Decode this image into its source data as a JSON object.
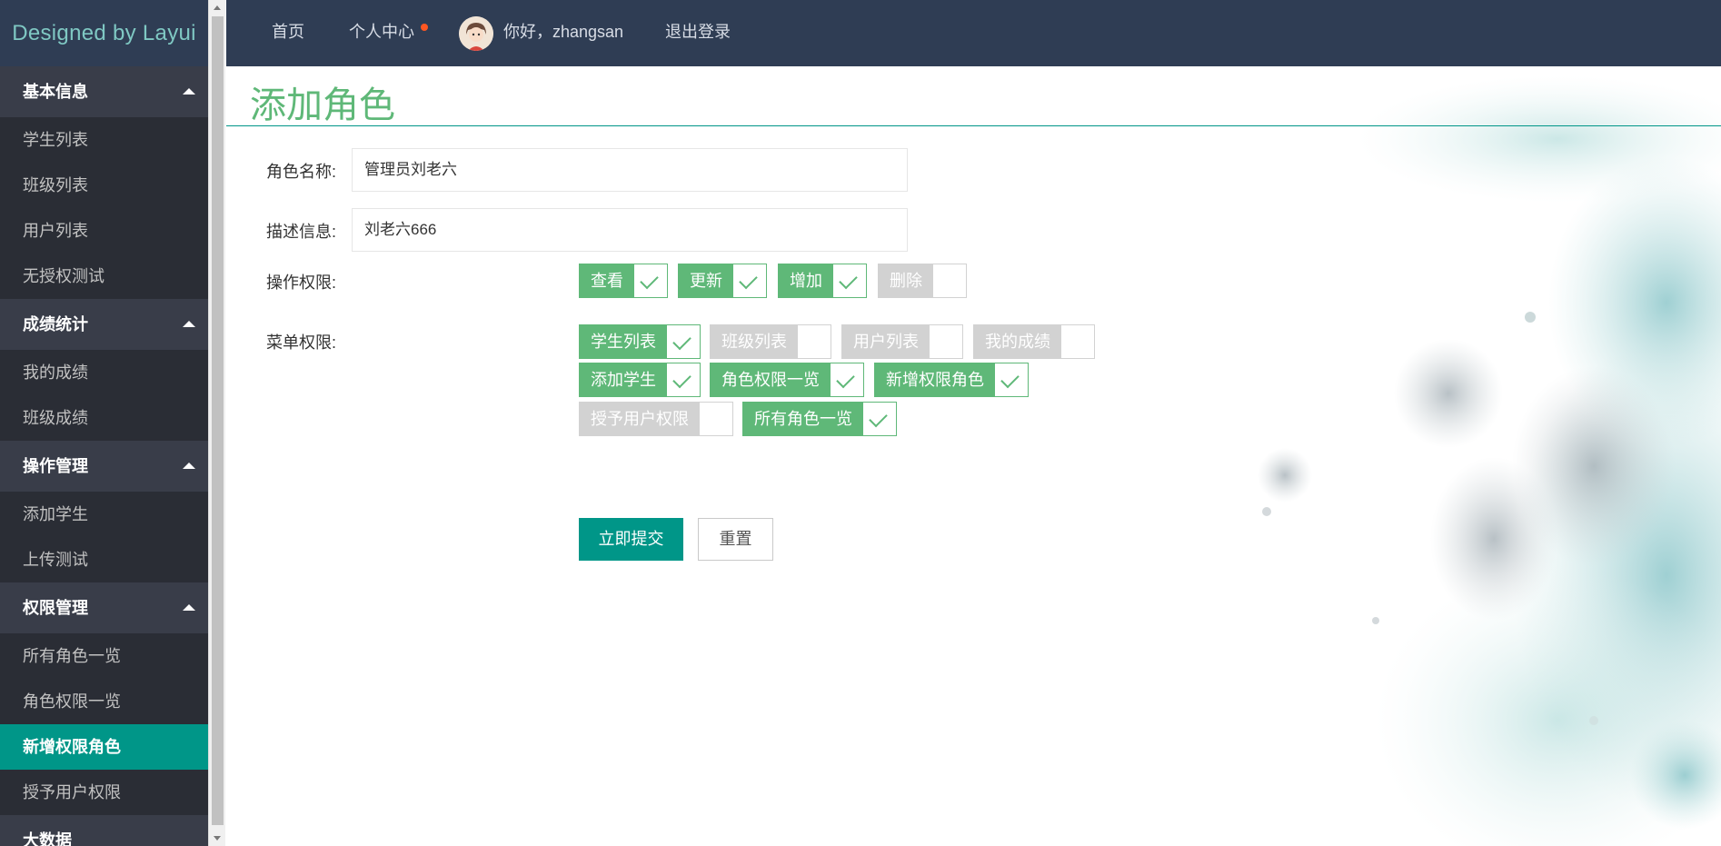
{
  "sidebar": {
    "logo": "Designed by Layui",
    "groups": [
      {
        "title": "基本信息",
        "items": [
          "学生列表",
          "班级列表",
          "用户列表",
          "无授权测试"
        ]
      },
      {
        "title": "成绩统计",
        "items": [
          "我的成绩",
          "班级成绩"
        ]
      },
      {
        "title": "操作管理",
        "items": [
          "添加学生",
          "上传测试"
        ]
      },
      {
        "title": "权限管理",
        "items": [
          "所有角色一览",
          "角色权限一览",
          "新增权限角色",
          "授予用户权限"
        ]
      },
      {
        "title": "大数据",
        "items": []
      }
    ],
    "active_item": "新增权限角色"
  },
  "header": {
    "home": "首页",
    "personal_center": "个人中心",
    "greeting": "你好，zhangsan",
    "logout": "退出登录"
  },
  "page": {
    "title": "添加角色",
    "role_name_label": "角色名称:",
    "role_name_value": "管理员刘老六",
    "description_label": "描述信息:",
    "description_value": "刘老六666",
    "operation_label": "操作权限:",
    "operations": [
      {
        "label": "查看",
        "checked": true
      },
      {
        "label": "更新",
        "checked": true
      },
      {
        "label": "增加",
        "checked": true
      },
      {
        "label": "删除",
        "checked": false
      }
    ],
    "menu_label": "菜单权限:",
    "menus": [
      {
        "label": "学生列表",
        "checked": true
      },
      {
        "label": "班级列表",
        "checked": false
      },
      {
        "label": "用户列表",
        "checked": false
      },
      {
        "label": "我的成绩",
        "checked": false
      },
      {
        "label": "添加学生",
        "checked": true
      },
      {
        "label": "角色权限一览",
        "checked": true
      },
      {
        "label": "新增权限角色",
        "checked": true
      },
      {
        "label": "授予用户权限",
        "checked": false
      },
      {
        "label": "所有角色一览",
        "checked": true
      }
    ],
    "submit": "立即提交",
    "reset": "重置"
  },
  "colors": {
    "accent": "#009688",
    "checked_green": "#5fb878",
    "header_bg": "#2f3d54",
    "sidebar_bg": "#23262e"
  }
}
